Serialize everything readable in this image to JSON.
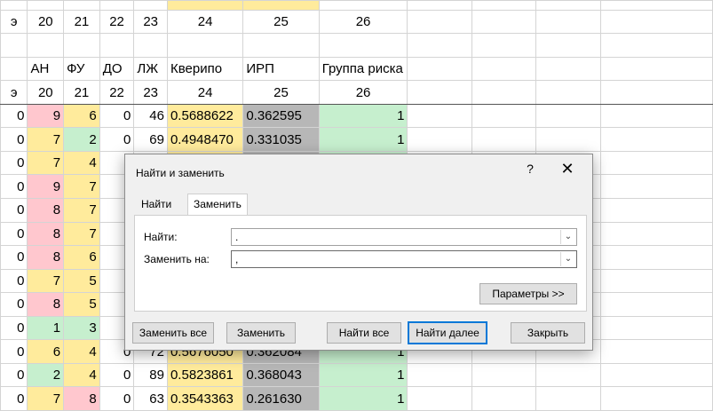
{
  "sheet": {
    "col_numbers": [
      "э",
      "20",
      "21",
      "22",
      "23",
      "24",
      "25",
      "26"
    ],
    "headers": [
      "",
      "АН",
      "ФУ",
      "ДО",
      "ЛЖ",
      "Кверипо",
      "ИРП",
      "Группа риска"
    ],
    "rows": [
      {
        "a": "0",
        "an": "9",
        "fu": "6",
        "do": "0",
        "lzh": "46",
        "k": "0.5688622",
        "irp": "0.362595",
        "g": "1"
      },
      {
        "a": "0",
        "an": "7",
        "fu": "2",
        "do": "0",
        "lzh": "69",
        "k": "0.4948470",
        "irp": "0.331035",
        "g": "1"
      },
      {
        "a": "0",
        "an": "7",
        "fu": "4",
        "do": "",
        "lzh": "",
        "k": "",
        "irp": "",
        "g": ""
      },
      {
        "a": "0",
        "an": "9",
        "fu": "7",
        "do": "",
        "lzh": "",
        "k": "",
        "irp": "",
        "g": ""
      },
      {
        "a": "0",
        "an": "8",
        "fu": "7",
        "do": "",
        "lzh": "",
        "k": "",
        "irp": "",
        "g": ""
      },
      {
        "a": "0",
        "an": "8",
        "fu": "7",
        "do": "",
        "lzh": "",
        "k": "",
        "irp": "",
        "g": ""
      },
      {
        "a": "0",
        "an": "8",
        "fu": "6",
        "do": "",
        "lzh": "",
        "k": "",
        "irp": "",
        "g": ""
      },
      {
        "a": "0",
        "an": "7",
        "fu": "5",
        "do": "",
        "lzh": "",
        "k": "",
        "irp": "",
        "g": ""
      },
      {
        "a": "0",
        "an": "8",
        "fu": "5",
        "do": "",
        "lzh": "",
        "k": "",
        "irp": "",
        "g": ""
      },
      {
        "a": "0",
        "an": "1",
        "fu": "3",
        "do": "",
        "lzh": "",
        "k": "",
        "irp": "",
        "g": ""
      },
      {
        "a": "0",
        "an": "6",
        "fu": "4",
        "do": "0",
        "lzh": "72",
        "k": "0.5676050",
        "irp": "0.362084",
        "g": "1"
      },
      {
        "a": "0",
        "an": "2",
        "fu": "4",
        "do": "0",
        "lzh": "89",
        "k": "0.5823861",
        "irp": "0.368043",
        "g": "1"
      },
      {
        "a": "0",
        "an": "7",
        "fu": "8",
        "do": "0",
        "lzh": "63",
        "k": "0.3543363",
        "irp": "0.261630",
        "g": "1"
      }
    ]
  },
  "dialog": {
    "title": "Найти и заменить",
    "help": "?",
    "close": "✕",
    "tab_find": "Найти",
    "tab_replace": "Заменить",
    "find_label": "Найти:",
    "find_value": ".",
    "replace_label": "Заменить на:",
    "replace_value": ",",
    "options_button": "Параметры >>",
    "replace_all_button": "Заменить все",
    "replace_button": "Заменить",
    "find_all_button": "Найти все",
    "find_next_button": "Найти далее",
    "close_button": "Закрыть"
  }
}
